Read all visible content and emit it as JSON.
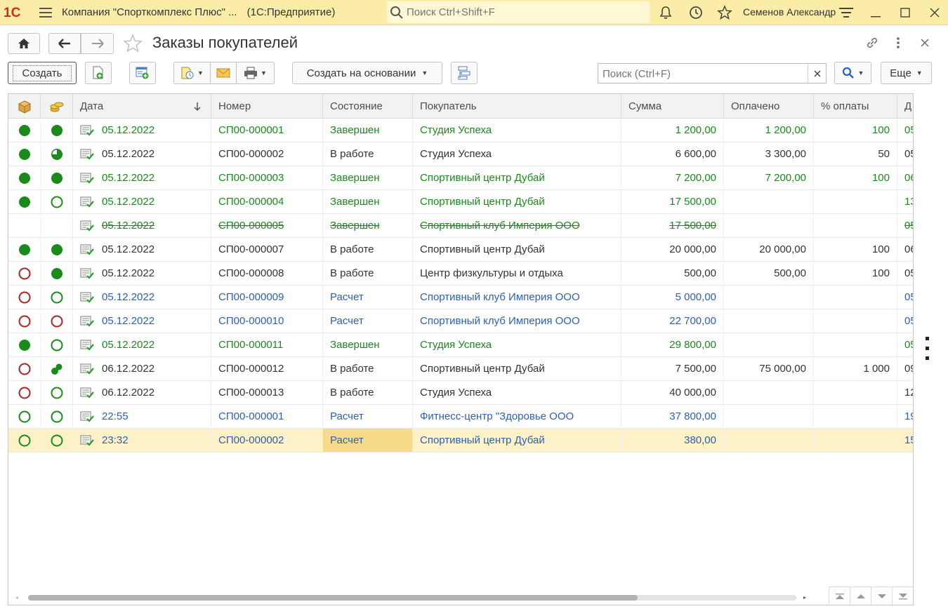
{
  "topbar": {
    "logo": "1C",
    "app_title": "Компания \"Спорткомплекс Плюс\" ...",
    "app_sub": "(1С:Предприятие)",
    "search_placeholder": "Поиск Ctrl+Shift+F",
    "user": "Семенов Александр",
    "icons": [
      "bell-icon",
      "history-icon",
      "star-icon",
      "menu-lines-icon",
      "minimize-icon",
      "maximize-icon",
      "close-icon"
    ]
  },
  "page": {
    "title": "Заказы покупателей"
  },
  "toolbar": {
    "create": "Создать",
    "create_based": "Создать на основании",
    "search_placeholder": "Поиск (Ctrl+F)",
    "more": "Еще"
  },
  "table": {
    "columns": [
      "Дата",
      "Номер",
      "Состояние",
      "Покупатель",
      "Сумма",
      "Оплачено",
      "% оплаты",
      "Д"
    ],
    "rows": [
      {
        "s1": "filled-green",
        "s2": "filled-green",
        "date": "05.12.2022",
        "num": "СП00-000001",
        "state": "Завершен",
        "buyer": "Студия Успеха",
        "sum": "1 200,00",
        "paid": "1 200,00",
        "pct": "100",
        "d": "05",
        "color": "green"
      },
      {
        "s1": "filled-green",
        "s2": "partial-green",
        "date": "05.12.2022",
        "num": "СП00-000002",
        "state": "В работе",
        "buyer": "Студия Успеха",
        "sum": "6 600,00",
        "paid": "3 300,00",
        "pct": "50",
        "d": "05",
        "color": "dark"
      },
      {
        "s1": "filled-green",
        "s2": "filled-green",
        "date": "05.12.2022",
        "num": "СП00-000003",
        "state": "Завершен",
        "buyer": "Спортивный центр Дубай",
        "sum": "7 200,00",
        "paid": "7 200,00",
        "pct": "100",
        "d": "06",
        "color": "green"
      },
      {
        "s1": "filled-green",
        "s2": "ring-green",
        "date": "05.12.2022",
        "num": "СП00-000004",
        "state": "Завершен",
        "buyer": "Спортивный центр Дубай",
        "sum": "17 500,00",
        "paid": "",
        "pct": "",
        "d": "13",
        "color": "green"
      },
      {
        "s1": "none",
        "s2": "none",
        "date": "05.12.2022",
        "num": "СП00-000005",
        "state": "Завершен",
        "buyer": "Спортивный клуб Империя ООО",
        "sum": "17 500,00",
        "paid": "",
        "pct": "",
        "d": "05",
        "color": "green-strike"
      },
      {
        "s1": "filled-green",
        "s2": "filled-green",
        "date": "05.12.2022",
        "num": "СП00-000007",
        "state": "В работе",
        "buyer": "Спортивный центр Дубай",
        "sum": "20 000,00",
        "paid": "20 000,00",
        "pct": "100",
        "d": "06",
        "color": "dark"
      },
      {
        "s1": "ring-red",
        "s2": "filled-green",
        "date": "05.12.2022",
        "num": "СП00-000008",
        "state": "В работе",
        "buyer": "Центр физкультуры и отдыха",
        "sum": "500,00",
        "paid": "500,00",
        "pct": "100",
        "d": "05",
        "color": "dark"
      },
      {
        "s1": "ring-red",
        "s2": "ring-green",
        "date": "05.12.2022",
        "num": "СП00-000009",
        "state": "Расчет",
        "buyer": "Спортивный клуб Империя ООО",
        "sum": "5 000,00",
        "paid": "",
        "pct": "",
        "d": "05",
        "color": "blue"
      },
      {
        "s1": "ring-red",
        "s2": "ring-red",
        "date": "05.12.2022",
        "num": "СП00-000010",
        "state": "Расчет",
        "buyer": "Спортивный клуб Империя ООО",
        "sum": "22 700,00",
        "paid": "",
        "pct": "",
        "d": "05",
        "color": "blue"
      },
      {
        "s1": "filled-green",
        "s2": "ring-green",
        "date": "05.12.2022",
        "num": "СП00-000011",
        "state": "Завершен",
        "buyer": "Студия Успеха",
        "sum": "29 800,00",
        "paid": "",
        "pct": "",
        "d": "05",
        "color": "green"
      },
      {
        "s1": "ring-red",
        "s2": "split-green",
        "date": "06.12.2022",
        "num": "СП00-000012",
        "state": "В работе",
        "buyer": "Спортивный центр Дубай",
        "sum": "7 500,00",
        "paid": "75 000,00",
        "pct": "1 000",
        "d": "09",
        "color": "dark"
      },
      {
        "s1": "ring-red",
        "s2": "ring-green",
        "date": "06.12.2022",
        "num": "СП00-000013",
        "state": "В работе",
        "buyer": "Студия Успеха",
        "sum": "40 000,00",
        "paid": "",
        "pct": "",
        "d": "12",
        "color": "dark"
      },
      {
        "s1": "ring-green",
        "s2": "ring-green",
        "date": "22:55",
        "num": "СП00-000001",
        "state": "Расчет",
        "buyer": "Фитнесс-центр \"Здоровье ООО",
        "sum": "37 800,00",
        "paid": "",
        "pct": "",
        "d": "19",
        "color": "blue"
      },
      {
        "s1": "ring-green",
        "s2": "ring-green",
        "date": "23:32",
        "num": "СП00-000002",
        "state": "Расчет",
        "buyer": "Спортивный центр Дубай",
        "sum": "380,00",
        "paid": "",
        "pct": "",
        "d": "15",
        "color": "blue",
        "selected": true
      }
    ]
  },
  "colors": {
    "topbar_bg": "#fbeda8",
    "green": "#1a8a1a",
    "blue": "#2d5fb3",
    "red": "#b22222",
    "selected_row": "#fcf1c7",
    "selected_cell": "#f8db8a"
  }
}
